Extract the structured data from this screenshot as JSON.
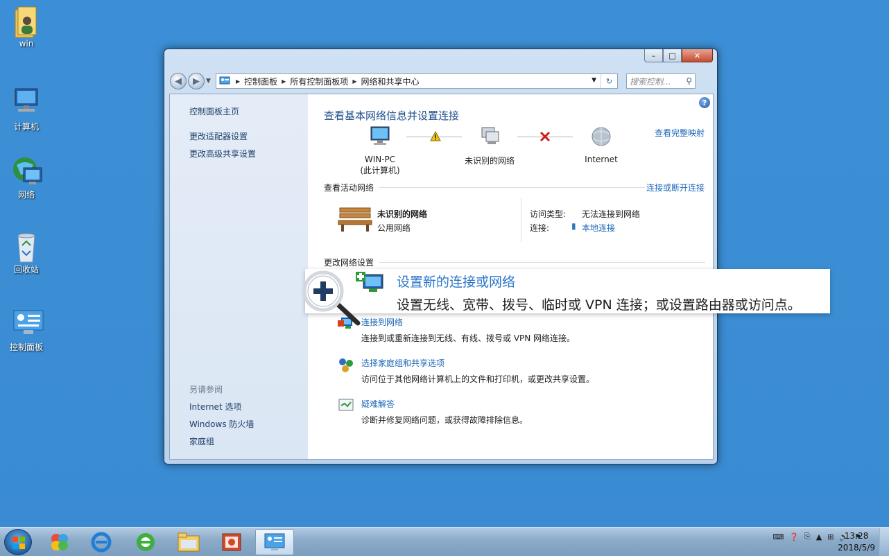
{
  "desktop": {
    "icons": [
      {
        "label": "win",
        "icon": "user-folder-icon"
      },
      {
        "label": "计算机",
        "icon": "computer-icon"
      },
      {
        "label": "网络",
        "icon": "network-globe-icon"
      },
      {
        "label": "回收站",
        "icon": "recycle-bin-icon"
      },
      {
        "label": "控制面板",
        "icon": "control-panel-icon"
      }
    ]
  },
  "window": {
    "buttons": {
      "minimize": "–",
      "maximize": "□",
      "close": "✕"
    },
    "breadcrumb": [
      "控制面板",
      "所有控制面板项",
      "网络和共享中心"
    ],
    "search_placeholder": "搜索控制...",
    "sidebar": {
      "home": "控制面板主页",
      "links": [
        "更改适配器设置",
        "更改高级共享设置"
      ],
      "see_also_heading": "另请参阅",
      "see_also": [
        "Internet 选项",
        "Windows 防火墙",
        "家庭组"
      ]
    },
    "main": {
      "title": "查看基本网络信息并设置连接",
      "full_map_link": "查看完整映射",
      "map": {
        "pc_name": "WIN-PC",
        "pc_sub": "(此计算机)",
        "middle": "未识别的网络",
        "internet": "Internet"
      },
      "active_heading": "查看活动网络",
      "connect_disconnect": "连接或断开连接",
      "active_network": {
        "name": "未识别的网络",
        "type": "公用网络",
        "access_label": "访问类型:",
        "access_value": "无法连接到网络",
        "conn_label": "连接:",
        "conn_value": "本地连接"
      },
      "change_heading": "更改网络设置",
      "tasks": [
        {
          "title": "连接到网络",
          "desc": "连接到或重新连接到无线、有线、拨号或 VPN 网络连接。"
        },
        {
          "title": "选择家庭组和共享选项",
          "desc": "访问位于其他网络计算机上的文件和打印机，或更改共享设置。"
        },
        {
          "title": "疑难解答",
          "desc": "诊断并修复网络问题，或获得故障排除信息。"
        }
      ],
      "callout": {
        "title": "设置新的连接或网络",
        "desc": "设置无线、宽带、拨号、临时或 VPN 连接；或设置路由器或访问点。"
      }
    }
  },
  "taskbar": {
    "time": "13:28",
    "date": "2018/5/9"
  }
}
